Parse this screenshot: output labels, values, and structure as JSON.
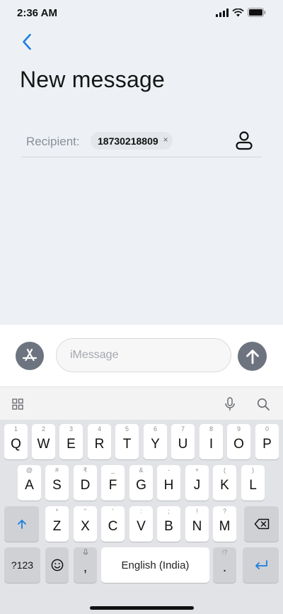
{
  "status_bar": {
    "time": "2:36 AM"
  },
  "header": {
    "title": "New message"
  },
  "recipient": {
    "label": "Recipient:",
    "chip_value": "18730218809",
    "chip_remove": "×"
  },
  "compose": {
    "placeholder": "iMessage"
  },
  "keyboard": {
    "row1": [
      {
        "hint": "1",
        "char": "Q"
      },
      {
        "hint": "2",
        "char": "W"
      },
      {
        "hint": "3",
        "char": "E"
      },
      {
        "hint": "4",
        "char": "R"
      },
      {
        "hint": "5",
        "char": "T"
      },
      {
        "hint": "6",
        "char": "Y"
      },
      {
        "hint": "7",
        "char": "U"
      },
      {
        "hint": "8",
        "char": "I"
      },
      {
        "hint": "9",
        "char": "O"
      },
      {
        "hint": "0",
        "char": "P"
      }
    ],
    "row2": [
      {
        "hint": "@",
        "char": "A"
      },
      {
        "hint": "#",
        "char": "S"
      },
      {
        "hint": "₹",
        "char": "D"
      },
      {
        "hint": "_",
        "char": "F"
      },
      {
        "hint": "&",
        "char": "G"
      },
      {
        "hint": "-",
        "char": "H"
      },
      {
        "hint": "+",
        "char": "J"
      },
      {
        "hint": "(",
        "char": "K"
      },
      {
        "hint": ")",
        "char": "L"
      }
    ],
    "row3": [
      {
        "hint": "*",
        "char": "Z"
      },
      {
        "hint": "\"",
        "char": "X"
      },
      {
        "hint": "'",
        "char": "C"
      },
      {
        "hint": ":",
        "char": "V"
      },
      {
        "hint": ";",
        "char": "B"
      },
      {
        "hint": "!",
        "char": "N"
      },
      {
        "hint": "?",
        "char": "M"
      }
    ],
    "symbols_label": "?123",
    "comma": ",",
    "space_label": "English (India)",
    "period": ".",
    "period_hint": "!?"
  }
}
